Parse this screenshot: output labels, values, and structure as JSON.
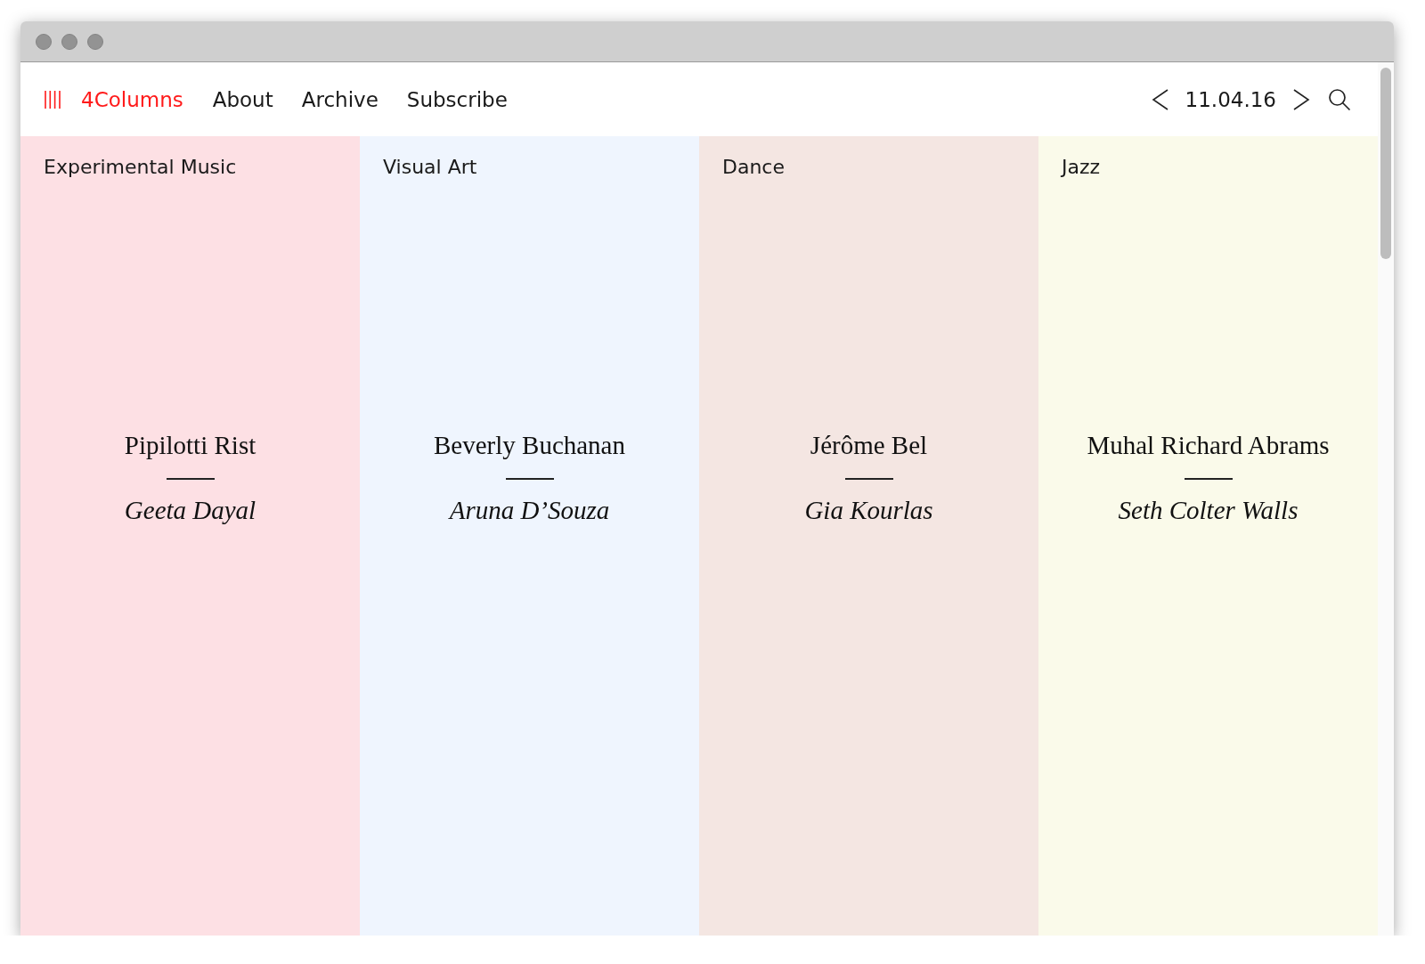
{
  "site": {
    "name": "4Columns"
  },
  "nav": [
    "About",
    "Archive",
    "Subscribe"
  ],
  "date": "11.04.16",
  "columns": [
    {
      "category": "Experimental Music",
      "title": "Pipilotti Rist",
      "author": "Geeta Dayal",
      "color": "#fde0e4"
    },
    {
      "category": "Visual Art",
      "title": "Beverly Buchanan",
      "author": "Aruna D’Souza",
      "color": "#eff5fe"
    },
    {
      "category": "Dance",
      "title": "Jérôme Bel",
      "author": "Gia Kourlas",
      "color": "#f4e6e2"
    },
    {
      "category": "Jazz",
      "title": "Muhal Richard Abrams",
      "author": "Seth Colter Walls",
      "color": "#fafaea"
    }
  ]
}
